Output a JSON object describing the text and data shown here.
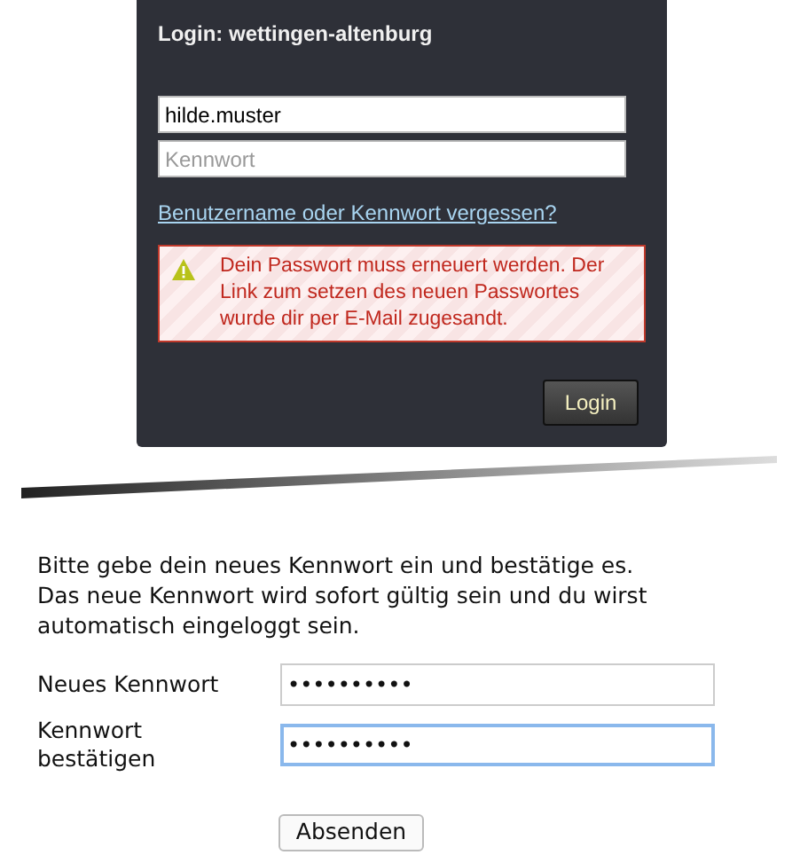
{
  "login_panel": {
    "title": "Login: wettingen-altenburg",
    "username": {
      "value": "hilde.muster"
    },
    "password": {
      "placeholder": "Kennwort"
    },
    "forgot_link": "Benutzername oder Kennwort vergessen?",
    "alert": {
      "kind": "warning",
      "text": "Dein Passwort muss erneuert werden. Der Link zum setzen des neuen Passwortes wurde dir per E-Mail zugesandt."
    },
    "login_button": "Login"
  },
  "intro": "Bitte gebe dein neues Kennwort ein und bestätige es. Das neue Kennwort wird sofort gültig sein und du wirst automatisch eingeloggt sein.",
  "fields": [
    {
      "label": "Neues Kennwort",
      "value": "••••••••••",
      "focused": false
    },
    {
      "label": "Kennwort bestätigen",
      "value": "••••••••••",
      "focused": true
    }
  ],
  "submit_button": "Absenden"
}
